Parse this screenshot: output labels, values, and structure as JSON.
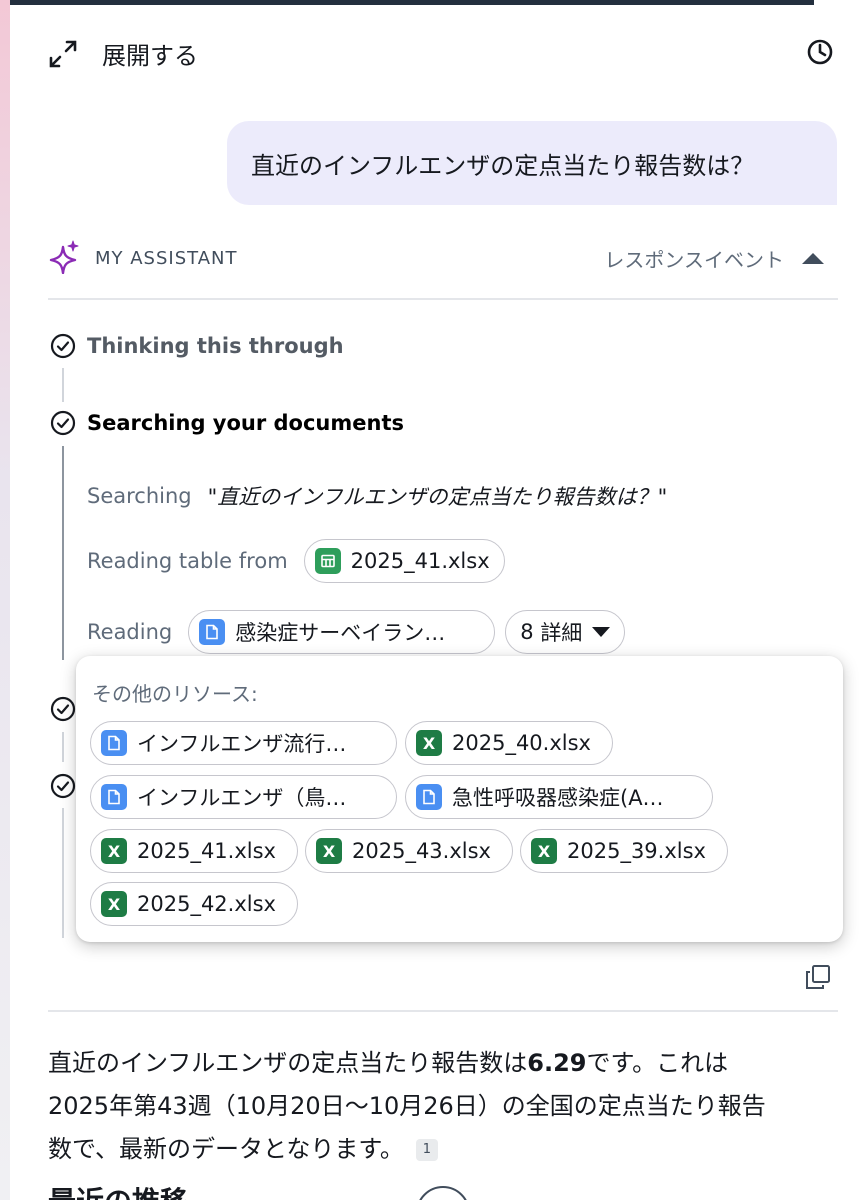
{
  "header": {
    "expand_label": "展開する"
  },
  "user_message": "直近のインフルエンザの定点当たり報告数は？",
  "assistant": {
    "name": "MY ASSISTANT",
    "response_events_label": "レスポンスイベント"
  },
  "steps": {
    "thinking": "Thinking this through",
    "searching": "Searching your documents"
  },
  "search": {
    "label": "Searching",
    "query": "\"直近のインフルエンザの定点当たり報告数は？\""
  },
  "reading_table": {
    "label": "Reading table from",
    "file": "2025_41.xlsx"
  },
  "reading": {
    "label": "Reading",
    "file": "感染症サーベイラン…",
    "more_count": "8",
    "more_label": "詳細"
  },
  "popover": {
    "title": "その他のリソース:",
    "resources": [
      {
        "type": "doc",
        "name": "インフルエンザ流行…"
      },
      {
        "type": "xlsx",
        "name": "2025_40.xlsx"
      },
      {
        "type": "doc",
        "name": "インフルエンザ（鳥…"
      },
      {
        "type": "doc",
        "name": "急性呼吸器感染症(A…"
      },
      {
        "type": "xlsx",
        "name": "2025_41.xlsx"
      },
      {
        "type": "xlsx",
        "name": "2025_43.xlsx"
      },
      {
        "type": "xlsx",
        "name": "2025_39.xlsx"
      },
      {
        "type": "xlsx",
        "name": "2025_42.xlsx"
      }
    ]
  },
  "answer": {
    "line1_pre": "直近のインフルエンザの定点当たり報告数は",
    "value": "6.29",
    "line1_post": "です。これは",
    "line2": "2025年第43週（10月20日〜10月26日）の全国の定点当たり報告",
    "line3": "数で、最新のデータとなります。",
    "citation": "1"
  },
  "next_heading": "最近の推移",
  "icons": {
    "expand": "expand-arrows-icon",
    "history": "clock-icon",
    "assistant": "sparkle-icon",
    "step": "check-circle-icon",
    "copy": "copy-icon",
    "doc": "document-icon",
    "xlsx": "excel-icon",
    "table": "table-icon"
  },
  "colors": {
    "accent": "#8b2bb5",
    "user_bubble": "#ecebfb",
    "doc_icon": "#4a8ff2",
    "xlsx_icon": "#1e7c45"
  }
}
